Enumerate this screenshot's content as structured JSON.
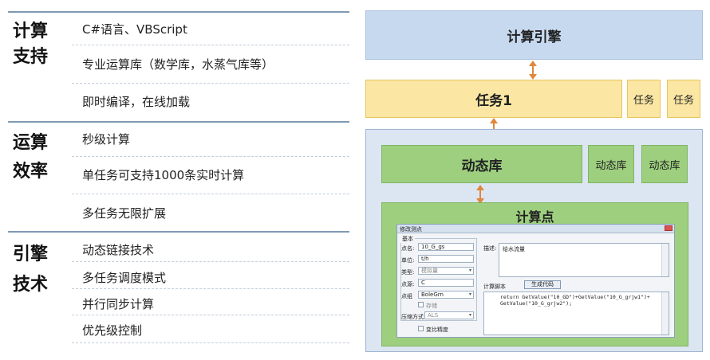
{
  "left": {
    "sections": [
      {
        "title_line1": "计算",
        "title_line2": "支持",
        "items": [
          "C#语言、VBScript",
          "专业运算库（数学库，水蒸气库等）",
          "即时编译，在线加载"
        ]
      },
      {
        "title_line1": "运算",
        "title_line2": "效率",
        "items": [
          "秒级计算",
          "单任务可支持1000条实时计算",
          "多任务无限扩展"
        ]
      },
      {
        "title_line1": "引擎",
        "title_line2": "技术",
        "items": [
          "动态链接技术",
          "多任务调度模式",
          "并行同步计算",
          "优先级控制"
        ]
      }
    ]
  },
  "diagram": {
    "engine": "计算引擎",
    "task_main": "任务1",
    "task_small": [
      "任务",
      "任务"
    ],
    "lib_main": "动态库",
    "lib_small": [
      "动态库",
      "动态库"
    ],
    "calc_point": "计算点"
  },
  "dialog": {
    "title": "修改测点",
    "group": "基本",
    "name_label": "点名:",
    "name_value": "10_G_gs",
    "unit_label": "单位:",
    "unit_value": "t/h",
    "type_label": "类型:",
    "type_value": "模拟量",
    "source_label": "点源:",
    "source_value": "C",
    "group_label": "点组",
    "group_value": "BoleGrn",
    "store_label": "存储",
    "compress_label": "压缩方式:",
    "compress_value": "ALS",
    "varcomp_label": "变比精度",
    "desc_label": "描述:",
    "desc_value": "给水流量",
    "script_label": "计算脚本",
    "gen_button": "生成代码",
    "script_code": "return GetValue(\"10_GD\")+GetValue(\"10_G_grjw1\")+\nGetValue(\"10_G_grjw2\");"
  },
  "colors": {
    "engine_fill": "#c6d9ef",
    "task_fill": "#fbe7a3",
    "outer_fill": "#dce6f2",
    "lib_fill": "#9dcf7f",
    "arrow": "#e0873c"
  }
}
